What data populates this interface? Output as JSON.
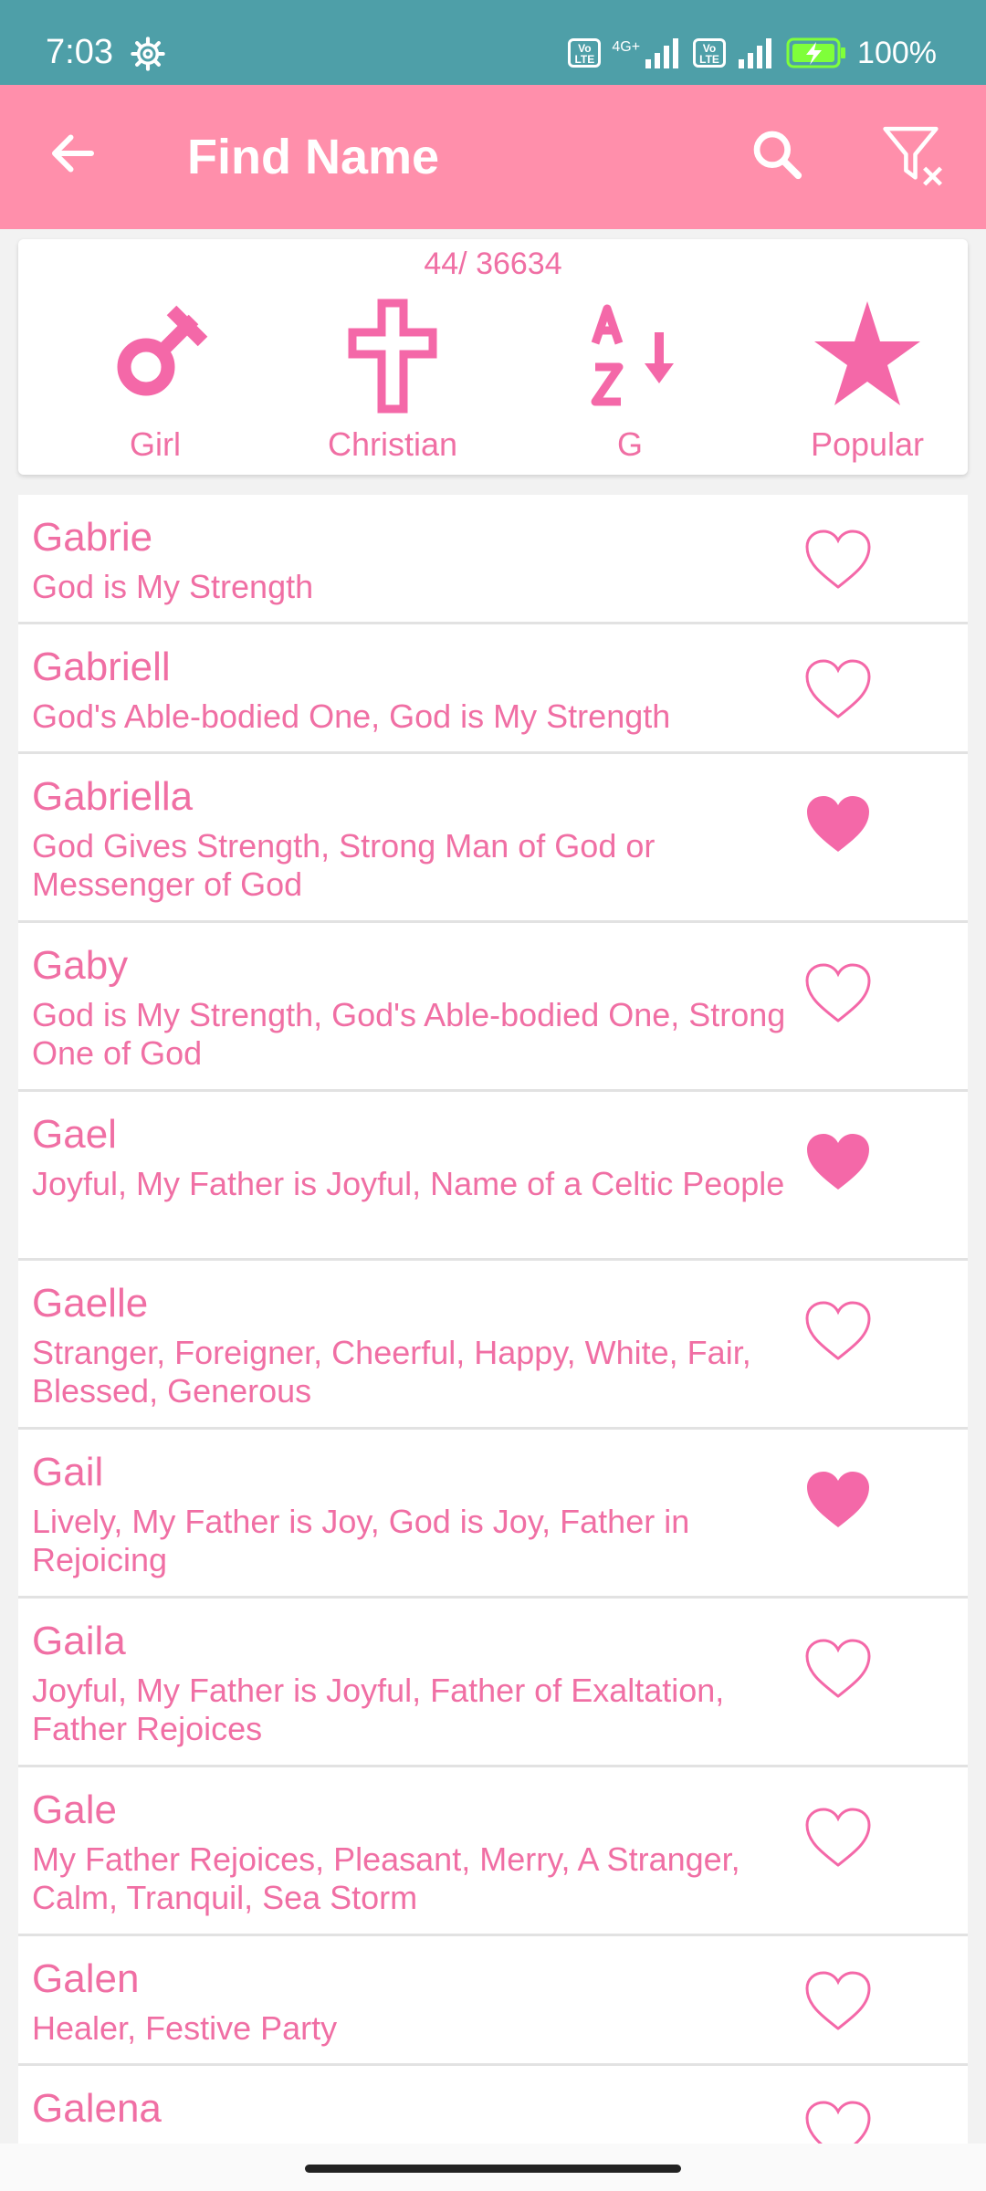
{
  "status_bar": {
    "time": "7:03",
    "network": "4G+",
    "battery": "100%"
  },
  "app_bar": {
    "title": "Find Name"
  },
  "filters": {
    "count": "44/ 36634",
    "gender_label": "Girl",
    "religion_label": "Christian",
    "letter_label": "G",
    "sort_label": "Popular"
  },
  "names": [
    {
      "name": "Gabrie",
      "meaning": "God is My Strength",
      "favorite": false
    },
    {
      "name": "Gabriell",
      "meaning": "God's Able-bodied One, God is My Strength",
      "favorite": false
    },
    {
      "name": "Gabriella",
      "meaning": "God Gives Strength, Strong Man of God or Messenger of God",
      "favorite": true
    },
    {
      "name": "Gaby",
      "meaning": "God is My Strength, God's Able-bodied One, Strong One of God",
      "favorite": false
    },
    {
      "name": "Gael",
      "meaning": "Joyful, My Father is Joyful, Name of a Celtic People",
      "favorite": true
    },
    {
      "name": "Gaelle",
      "meaning": "Stranger, Foreigner, Cheerful, Happy, White, Fair, Blessed, Generous",
      "favorite": false
    },
    {
      "name": "Gail",
      "meaning": "Lively, My Father is Joy, God is Joy, Father in Rejoicing",
      "favorite": true
    },
    {
      "name": "Gaila",
      "meaning": "Joyful, My Father is Joyful, Father of Exaltation, Father Rejoices",
      "favorite": false
    },
    {
      "name": "Gale",
      "meaning": "My Father Rejoices, Pleasant, Merry, A Stranger, Calm, Tranquil, Sea Storm",
      "favorite": false
    },
    {
      "name": "Galen",
      "meaning": "Healer, Festive Party",
      "favorite": false
    },
    {
      "name": "Galena",
      "meaning": "",
      "favorite": false
    }
  ],
  "colors": {
    "status_bar": "#4e9fa8",
    "app_bar": "#ff8fab",
    "accent_pink": "#f06fa4",
    "heart_fill": "#f468a8"
  },
  "icons": {
    "back": "arrow-left-icon",
    "search": "search-icon",
    "clear_filter": "filter-clear-icon",
    "gender": "female-symbol-icon",
    "religion": "cross-icon",
    "letter": "az-sort-icon",
    "sort": "star-icon",
    "favorite": "heart-icon"
  }
}
